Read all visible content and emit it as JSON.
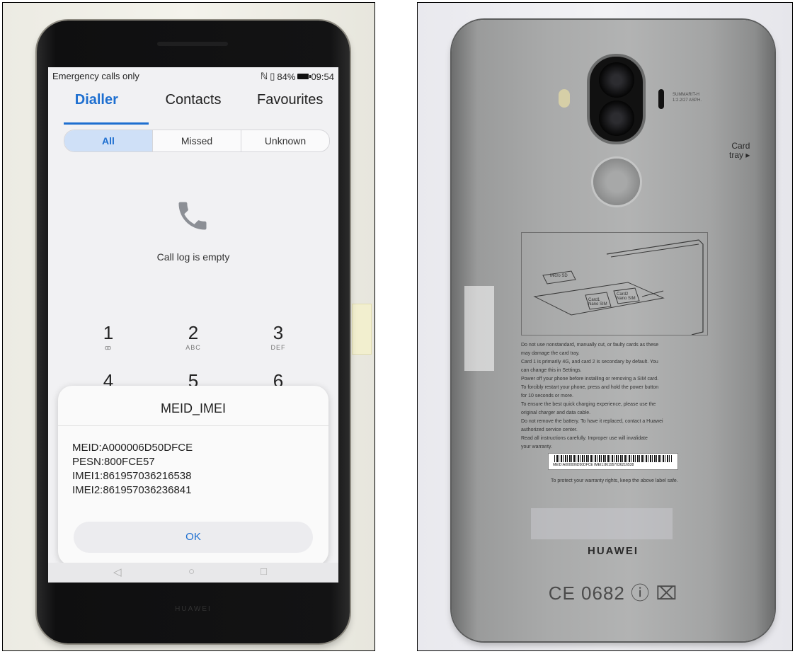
{
  "front_phone": {
    "status_left": "Emergency calls only",
    "status_right": "84%",
    "time": "09:54",
    "tabs": [
      {
        "label": "Dialler"
      },
      {
        "label": "Contacts"
      },
      {
        "label": "Favourites"
      }
    ],
    "filters": [
      {
        "label": "All"
      },
      {
        "label": "Missed"
      },
      {
        "label": "Unknown"
      }
    ],
    "call_log_empty": "Call log is empty",
    "keypad": [
      {
        "digit": "1",
        "letters": "ꝏ"
      },
      {
        "digit": "2",
        "letters": "ABC"
      },
      {
        "digit": "3",
        "letters": "DEF"
      },
      {
        "digit": "4",
        "letters": ""
      },
      {
        "digit": "5",
        "letters": ""
      },
      {
        "digit": "6",
        "letters": ""
      }
    ],
    "dialog": {
      "title": "MEID_IMEI",
      "lines": [
        "MEID:A000006D50DFCE",
        "PESN:800FCE57",
        "IMEI1:861957036216538",
        "IMEI2:861957036236841"
      ],
      "ok_label": "OK"
    },
    "brand": "HUAWEI"
  },
  "back_phone": {
    "card_tray_label": "Card\ntray ▸",
    "lens_text": "SUMMARIT-H\n1:2.2/27 ASPH.",
    "sim_labels": [
      "Micro SD",
      "Card1 Nano SIM",
      "Card2 Nano SIM"
    ],
    "warning_lines": [
      "Do not use nonstandard, manually cut, or faulty cards as these",
      "may damage the card tray.",
      "Card 1 is primarily 4G, and card 2 is secondary by default. You",
      "can change this in Settings.",
      "Power off your phone before installing or removing a SIM card.",
      "To forcibly restart your phone, press and hold the power button",
      "for 10 seconds or more.",
      "To ensure the best quick charging experience, please use the",
      "original charger and data cable.",
      "Do not remove the battery. To have it replaced, contact a Huawei",
      "authorized service center.",
      "Read all instructions carefully. Improper use will invalidate",
      "your warranty."
    ],
    "barcode_text": "MEID:A000006D50DFCE   IMEI1:861957036216538",
    "label_note": "To protect your warranty rights, keep the above label safe.",
    "brand": "HUAWEI",
    "cert_marks": "CE 0682 ⓘ ⌧"
  },
  "colors": {
    "accent_blue": "#1e6fd0",
    "screen_bg": "#f1f1f3",
    "phone_black": "#111111",
    "phone_silver": "#a9aaaa"
  }
}
